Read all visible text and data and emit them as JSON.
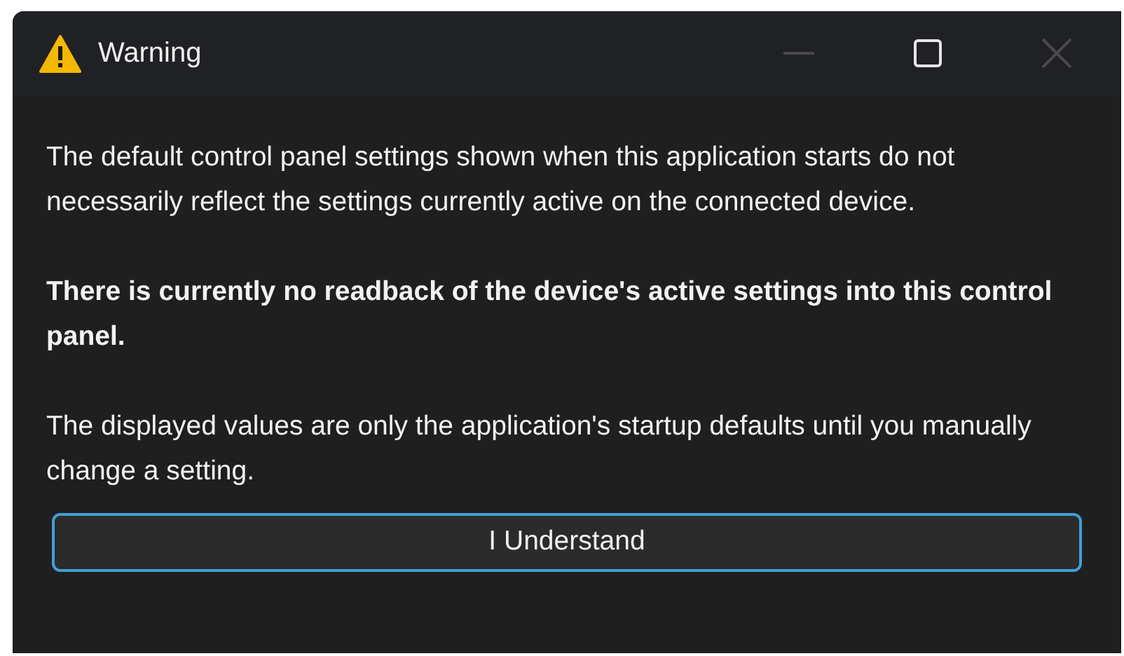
{
  "window": {
    "title": "Warning",
    "controls": [
      {
        "kind": "minimize",
        "disabled": true
      },
      {
        "kind": "maximize",
        "disabled": false
      },
      {
        "kind": "close",
        "disabled": true
      }
    ]
  },
  "paragraphs": [
    {
      "text": "The default control panel settings shown when this application starts do not necessarily reflect the settings currently active on the connected device.",
      "bold": false
    },
    {
      "text": "There is currently no readback of the device's active settings into this control panel.",
      "bold": true
    },
    {
      "text": "The displayed values are only the application's startup defaults until you manually change a setting.",
      "bold": false
    }
  ],
  "button": {
    "label": "I Understand"
  }
}
